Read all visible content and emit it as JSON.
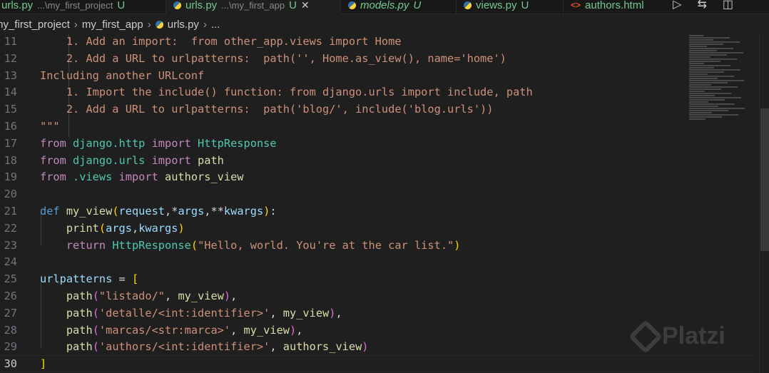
{
  "tabs": [
    {
      "name": "urls.py",
      "dir": "...\\my_first_project",
      "status": "U",
      "icon": "python-icon"
    },
    {
      "name": "urls.py",
      "dir": "...\\my_first_app",
      "status": "U",
      "icon": "python-icon",
      "active": true
    },
    {
      "name": "models.py",
      "status": "U",
      "icon": "python-icon"
    },
    {
      "name": "views.py",
      "status": "U",
      "icon": "python-icon"
    },
    {
      "name": "authors.html",
      "icon": "html-icon"
    }
  ],
  "breadcrumb": [
    "my_first_project",
    "my_first_app",
    "urls.py",
    "..."
  ],
  "watermark": "Platzi",
  "current_line": 30,
  "lines": [
    {
      "n": 11,
      "t": [
        [
          "    1. Add an import:  from other_app.views import Home",
          "str"
        ]
      ]
    },
    {
      "n": 12,
      "t": [
        [
          "    2. Add a URL to urlpatterns:  path('', Home.as_view(), name='home')",
          "str"
        ]
      ]
    },
    {
      "n": 13,
      "t": [
        [
          "Including another URLconf",
          "str"
        ]
      ]
    },
    {
      "n": 14,
      "t": [
        [
          "    1. Import the include() function: from django.urls import include, path",
          "str"
        ]
      ]
    },
    {
      "n": 15,
      "t": [
        [
          "    2. Add a URL to urlpatterns:  path('blog/', include('blog.urls'))",
          "str"
        ]
      ]
    },
    {
      "n": 16,
      "t": [
        [
          "\"\"\"",
          "str"
        ]
      ]
    },
    {
      "n": 17,
      "t": [
        [
          "from",
          "kw"
        ],
        [
          " django.http ",
          "cls"
        ],
        [
          "import",
          "kw"
        ],
        [
          " HttpResponse",
          "cls"
        ]
      ]
    },
    {
      "n": 18,
      "t": [
        [
          "from",
          "kw"
        ],
        [
          " django.urls ",
          "cls"
        ],
        [
          "import",
          "kw"
        ],
        [
          " path",
          "fn"
        ]
      ]
    },
    {
      "n": 19,
      "t": [
        [
          "from",
          "kw"
        ],
        [
          " .views ",
          "cls"
        ],
        [
          "import",
          "kw"
        ],
        [
          " authors_view",
          "fn"
        ]
      ]
    },
    {
      "n": 20,
      "t": []
    },
    {
      "n": 21,
      "t": [
        [
          "def",
          "def"
        ],
        [
          " my_view",
          "fn"
        ],
        [
          "(",
          "b1"
        ],
        [
          "request",
          "par"
        ],
        [
          ",*",
          "op"
        ],
        [
          "args",
          "par"
        ],
        [
          ",**",
          "op"
        ],
        [
          "kwargs",
          "par"
        ],
        [
          ")",
          "b1"
        ],
        [
          ":",
          "op"
        ]
      ]
    },
    {
      "n": 22,
      "t": [
        [
          "    ",
          "op"
        ],
        [
          "print",
          "fn"
        ],
        [
          "(",
          "b1"
        ],
        [
          "args",
          "var"
        ],
        [
          ",",
          "op"
        ],
        [
          "kwargs",
          "var"
        ],
        [
          ")",
          "b1"
        ]
      ]
    },
    {
      "n": 23,
      "t": [
        [
          "    ",
          "op"
        ],
        [
          "return",
          "kw"
        ],
        [
          " ",
          "op"
        ],
        [
          "HttpResponse",
          "cls"
        ],
        [
          "(",
          "b1"
        ],
        [
          "\"Hello, world. You're at the car list.\"",
          "str"
        ],
        [
          ")",
          "b1"
        ]
      ]
    },
    {
      "n": 24,
      "t": []
    },
    {
      "n": 25,
      "t": [
        [
          "urlpatterns",
          "var"
        ],
        [
          " = ",
          "op"
        ],
        [
          "[",
          "b1"
        ]
      ]
    },
    {
      "n": 26,
      "t": [
        [
          "    ",
          "op"
        ],
        [
          "path",
          "fn"
        ],
        [
          "(",
          "b2"
        ],
        [
          "\"listado/\"",
          "str"
        ],
        [
          ", ",
          "op"
        ],
        [
          "my_view",
          "fn"
        ],
        [
          ")",
          "b2"
        ],
        [
          ",",
          "op"
        ]
      ]
    },
    {
      "n": 27,
      "t": [
        [
          "    ",
          "op"
        ],
        [
          "path",
          "fn"
        ],
        [
          "(",
          "b2"
        ],
        [
          "'detalle/<int:identifier>'",
          "str"
        ],
        [
          ", ",
          "op"
        ],
        [
          "my_view",
          "fn"
        ],
        [
          ")",
          "b2"
        ],
        [
          ",",
          "op"
        ]
      ]
    },
    {
      "n": 28,
      "t": [
        [
          "    ",
          "op"
        ],
        [
          "path",
          "fn"
        ],
        [
          "(",
          "b2"
        ],
        [
          "'marcas/<str:marca>'",
          "str"
        ],
        [
          ", ",
          "op"
        ],
        [
          "my_view",
          "fn"
        ],
        [
          ")",
          "b2"
        ],
        [
          ",",
          "op"
        ]
      ]
    },
    {
      "n": 29,
      "t": [
        [
          "    ",
          "op"
        ],
        [
          "path",
          "fn"
        ],
        [
          "(",
          "b2"
        ],
        [
          "'authors/<int:identifier>'",
          "str"
        ],
        [
          ", ",
          "op"
        ],
        [
          "authors_view",
          "fn"
        ],
        [
          ")",
          "b2"
        ]
      ]
    },
    {
      "n": 30,
      "t": [
        [
          "]",
          "b1"
        ]
      ]
    }
  ]
}
